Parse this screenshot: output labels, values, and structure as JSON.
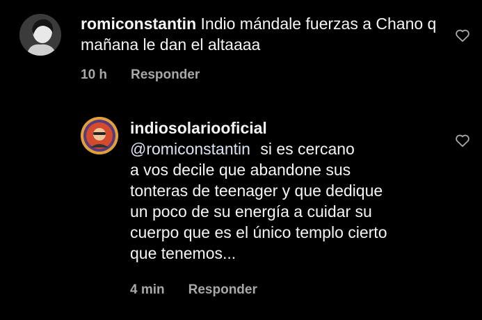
{
  "comments": [
    {
      "username": "romiconstantin",
      "body": "Indio mándale fuerzas a Chano q mañana le dan el altaaaa",
      "time": "10 h",
      "reply_label": "Responder",
      "like_icon": "heart-outline-icon"
    },
    {
      "username": "indiosolariooficial",
      "mention": "@romiconstantin",
      "body_line1": "si es cercano",
      "body_rest": [
        "a vos decile que abandone sus",
        "tonteras de teenager y que dedique",
        "un poco de su energía a cuidar su",
        "cuerpo que es el único templo cierto",
        "que tenemos..."
      ],
      "time": "4 min",
      "reply_label": "Responder",
      "like_icon": "heart-outline-icon"
    }
  ],
  "colors": {
    "background": "#000000",
    "text": "#f5f5f5",
    "meta": "#a8a8a8",
    "mention": "#dbe3f3"
  }
}
